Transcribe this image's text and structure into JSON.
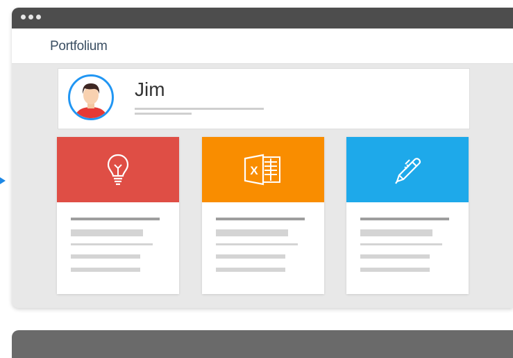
{
  "brand": "Portfolium",
  "profile": {
    "name": "Jim"
  },
  "cards": [
    {
      "icon": "lightbulb-icon",
      "color": "#df4e45"
    },
    {
      "icon": "excel-icon",
      "color": "#f98d00",
      "label": "X"
    },
    {
      "icon": "pen-icon",
      "color": "#1ea9ea"
    }
  ],
  "colors": {
    "titlebar": "#4d4d4d",
    "accent": "#2196f3",
    "background": "#e8e8e8"
  }
}
